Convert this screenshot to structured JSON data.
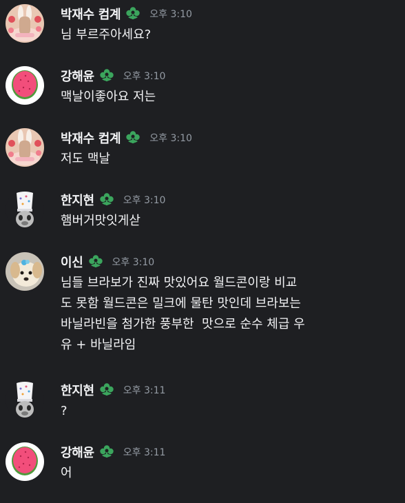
{
  "messages": [
    {
      "author": "박재수 컴계",
      "time": "오후 3:10",
      "text": "님 부르주아세요?",
      "avatar_icon": "bunny-heart-avatar-icon"
    },
    {
      "author": "강해윤",
      "time": "오후 3:10",
      "text": "맥날이좋아요 저는",
      "avatar_icon": "watermelon-avatar-icon"
    },
    {
      "author": "박재수 컴계",
      "time": "오후 3:10",
      "text": "저도 맥날",
      "avatar_icon": "bunny-heart-avatar-icon"
    },
    {
      "author": "한지현",
      "time": "오후 3:10",
      "text": "햄버거맛잇게삳",
      "avatar_icon": "cat-chef-avatar-icon"
    },
    {
      "author": "이신",
      "time": "오후 3:10",
      "text": "님들 브라보가 진짜 맛있어요 월드콘이랑 비교\n도 못함 월드콘은 밀크에 물탄 맛인데 브라보는\n바닐라빈을 첨가한 풍부한  맛으로 순수 체급 우\n유 + 바닐라임",
      "avatar_icon": "puppy-avatar-icon"
    },
    {
      "author": "한지현",
      "time": "오후 3:11",
      "text": "?",
      "avatar_icon": "cat-chef-avatar-icon"
    },
    {
      "author": "강해윤",
      "time": "오후 3:11",
      "text": "어",
      "avatar_icon": "watermelon-avatar-icon"
    }
  ],
  "badge_icon": "green-flower-badge-icon",
  "colors": {
    "background": "#1e1f22",
    "text": "#f2f3f5",
    "timestamp": "#949ba4",
    "badge": "#3ba55d"
  }
}
